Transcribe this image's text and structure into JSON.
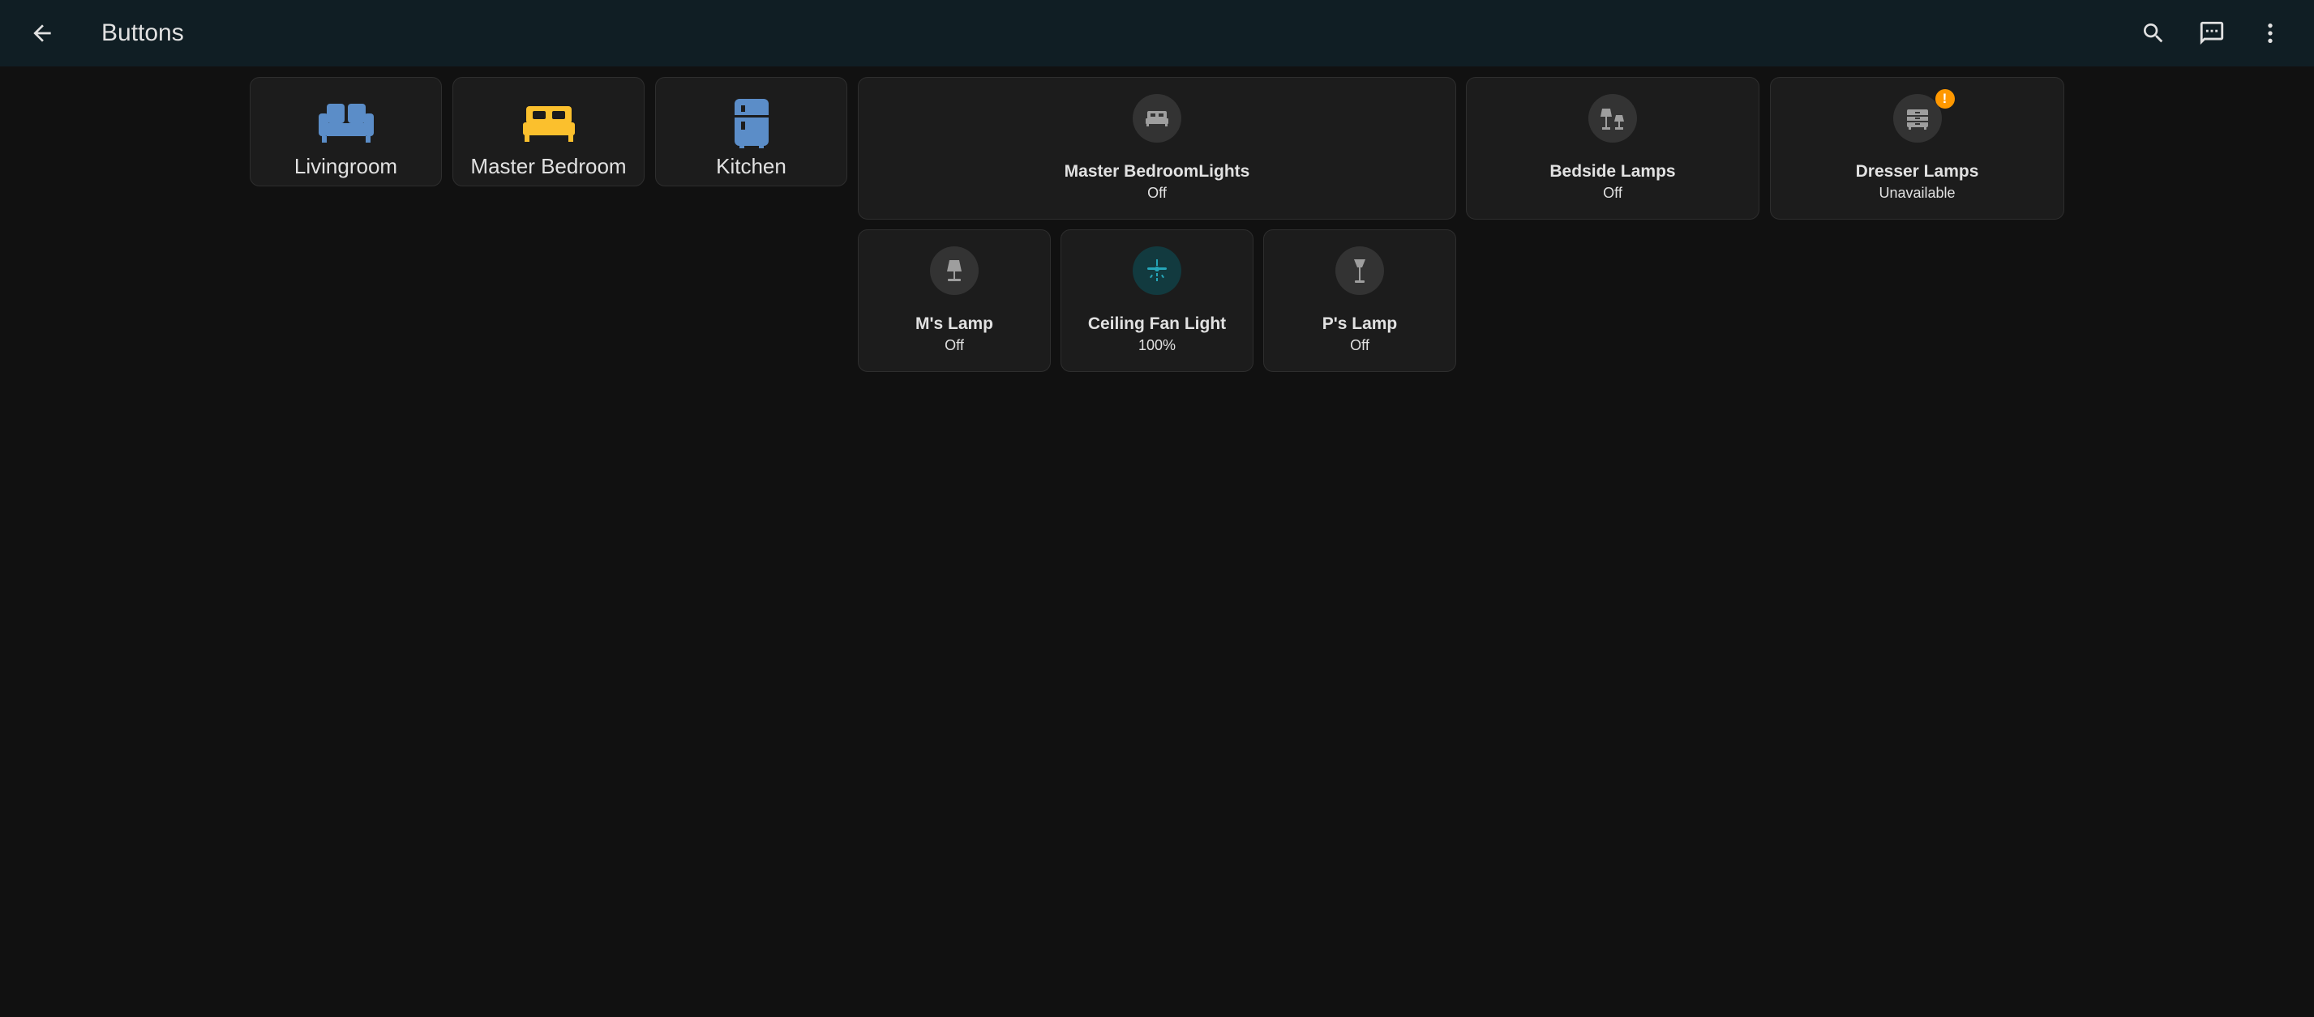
{
  "header": {
    "title": "Buttons",
    "icons": [
      "arrow-left-icon",
      "search-icon",
      "chat-message-icon",
      "dots-vertical-icon"
    ]
  },
  "areas": [
    {
      "label": "Livingroom",
      "icon": "sofa-icon",
      "color": "#5b8dc8"
    },
    {
      "label": "Master Bedroom",
      "icon": "bed-icon",
      "color": "#fbc02d"
    },
    {
      "label": "Kitchen",
      "icon": "fridge-icon",
      "color": "#5b8dc8"
    }
  ],
  "tiles": [
    {
      "name": "Master BedroomLights",
      "state": "Off",
      "icon": "bed-icon"
    },
    {
      "name": "Bedside Lamps",
      "state": "Off",
      "icon": "lamps-icon"
    },
    {
      "name": "Dresser Lamps",
      "state": "Unavailable",
      "icon": "dresser-icon",
      "badge": "!"
    },
    {
      "name": "M's Lamp",
      "state": "Off",
      "icon": "lamp-icon"
    },
    {
      "name": "Ceiling Fan Light",
      "state": "100%",
      "icon": "ceiling-fan-light-icon",
      "color": "#26a5b8"
    },
    {
      "name": "P's Lamp",
      "state": "Off",
      "icon": "floor-lamp-icon"
    }
  ],
  "colors": {
    "background": "#111111",
    "header": "#101e24",
    "card": "#1c1c1c",
    "icon_off": "#9e9e9e",
    "warning": "#ff9800"
  }
}
